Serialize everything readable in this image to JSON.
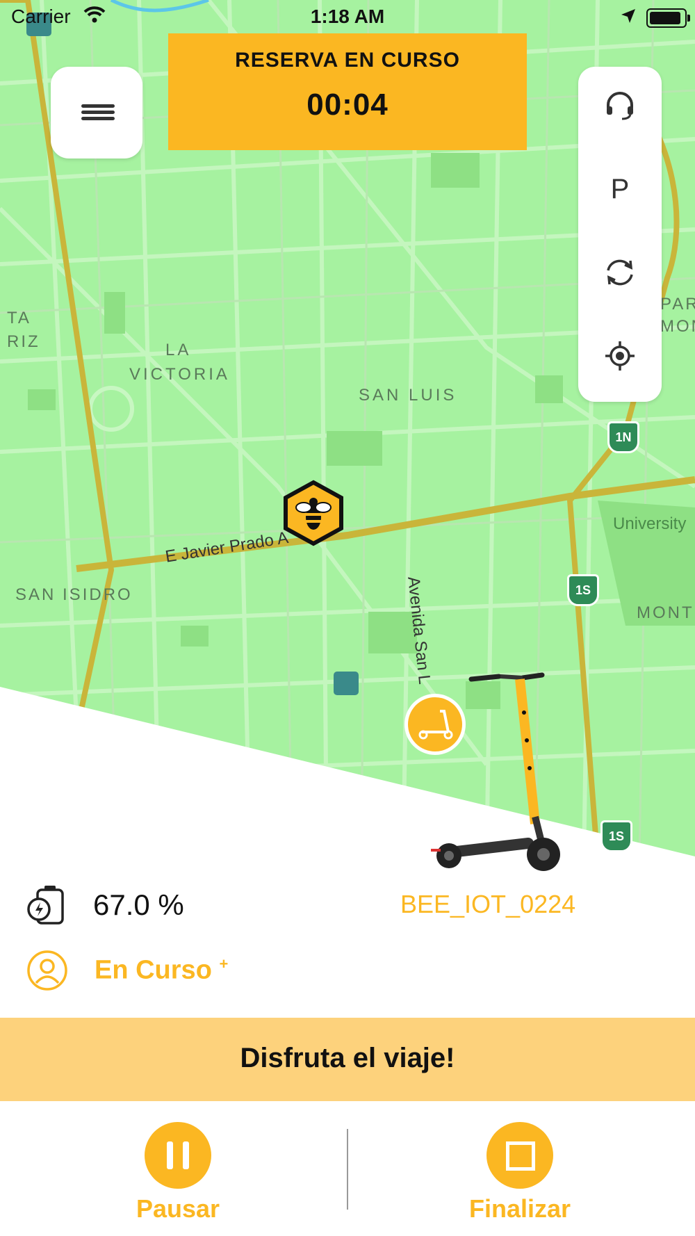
{
  "status_bar": {
    "carrier": "Carrier",
    "time": "1:18 AM"
  },
  "reservation": {
    "title": "RESERVA EN CURSO",
    "timer": "00:04"
  },
  "map": {
    "labels": {
      "victoria_1": "LA",
      "victoria_2": "VICTORIA",
      "san_luis": "SAN LUIS",
      "san_isidro": "SAN ISIDRO",
      "avenue_1": "E Javier Prado A",
      "avenue_2": "Avenida San L",
      "university": "University",
      "left_1": "TA",
      "left_2": "RIZ",
      "right_1": "PAR",
      "right_2": "MON",
      "right_3": "MONT",
      "shield_1n": "1N",
      "shield_1s": "1S",
      "shield_1s_b": "1S"
    }
  },
  "side_panel": {
    "items": [
      {
        "icon": "headset-icon"
      },
      {
        "icon": "parking-icon",
        "text": "P"
      },
      {
        "icon": "refresh-icon"
      },
      {
        "icon": "locate-icon"
      }
    ]
  },
  "vehicle": {
    "battery": "67.0 %",
    "id": "BEE_IOT_0224",
    "status": "En Curso",
    "status_mark": "+"
  },
  "banner": {
    "message": "Disfruta el viaje!"
  },
  "actions": {
    "pause": "Pausar",
    "finish": "Finalizar"
  },
  "colors": {
    "accent": "#fbb722",
    "banner": "#fdd27c",
    "map": "#a6f2a0"
  }
}
